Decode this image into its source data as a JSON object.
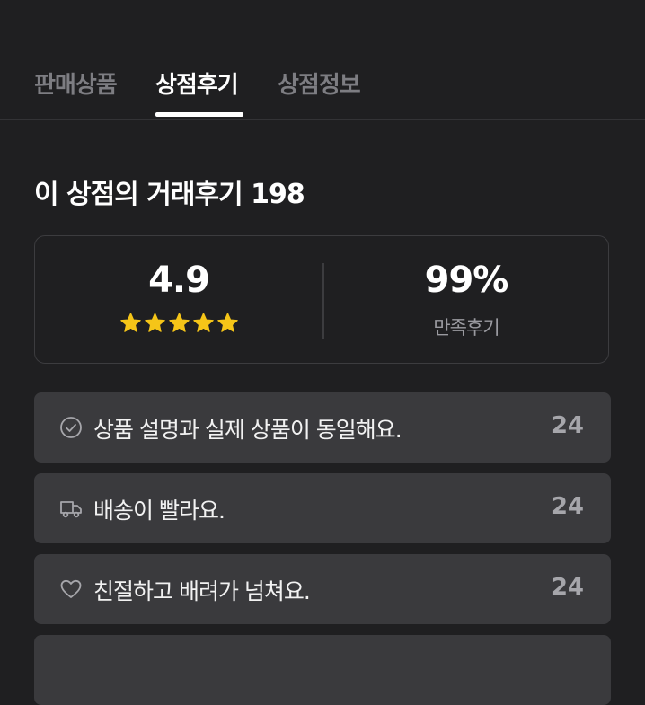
{
  "tabs": [
    {
      "label": "판매상품",
      "active": false
    },
    {
      "label": "상점후기",
      "active": true
    },
    {
      "label": "상점정보",
      "active": false
    }
  ],
  "heading": "이 상점의 거래후기 198",
  "summary": {
    "rating": "4.9",
    "stars": 5,
    "satisfaction": "99%",
    "satisfaction_label": "만족후기"
  },
  "reviews": [
    {
      "icon": "check-circle-icon",
      "label": "상품 설명과 실제 상품이 동일해요.",
      "count": "24"
    },
    {
      "icon": "truck-icon",
      "label": "배송이 빨라요.",
      "count": "24"
    },
    {
      "icon": "heart-icon",
      "label": "친절하고 배려가 넘쳐요.",
      "count": "24"
    }
  ],
  "colors": {
    "background": "#1f1f21",
    "card": "#3a3a3d",
    "star": "#f5c518"
  }
}
